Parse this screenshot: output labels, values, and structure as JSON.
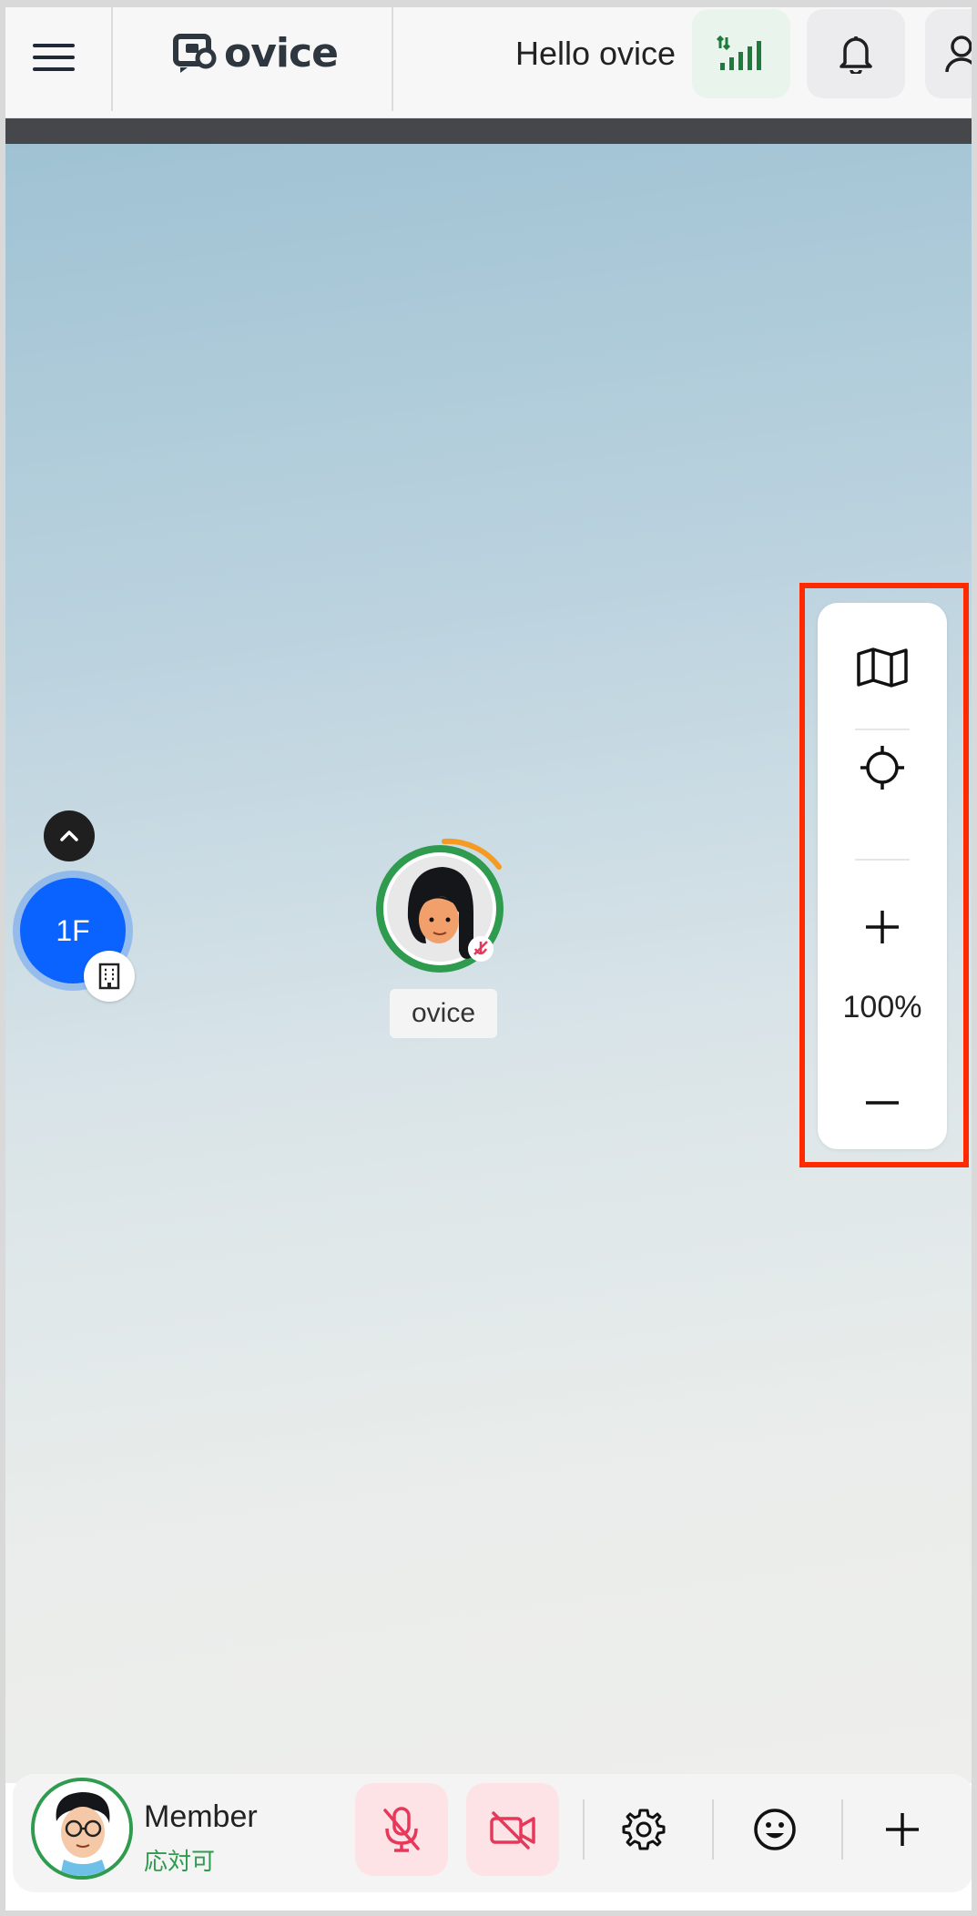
{
  "header": {
    "logo_text": "ovice",
    "greeting": "Hello ovice"
  },
  "zoom": {
    "level": "100%"
  },
  "floor": {
    "label": "1F"
  },
  "avatar": {
    "name": "ovice"
  },
  "me": {
    "name": "Member",
    "status": "応対可"
  },
  "colors": {
    "brand_dark": "#2e3640",
    "accent_green": "#2e9b4e",
    "floor_blue": "#0a63ff",
    "alert_pink": "#e8385a",
    "highlight_red": "#ff2a00"
  }
}
